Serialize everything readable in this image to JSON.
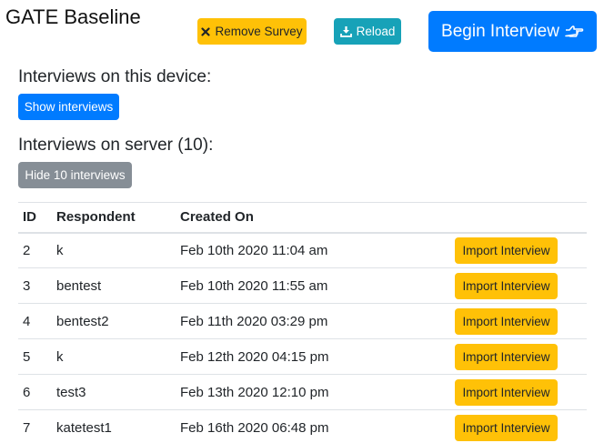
{
  "header": {
    "title": "GATE Baseline",
    "remove_label": "Remove Survey",
    "reload_label": "Reload",
    "begin_label": "Begin Interview"
  },
  "device_section": {
    "heading": "Interviews on this device:",
    "show_label": "Show interviews"
  },
  "server_section": {
    "heading": "Interviews on server (10):",
    "hide_label": "Hide 10 interviews"
  },
  "table": {
    "columns": [
      "ID",
      "Respondent",
      "Created On",
      ""
    ],
    "rows": [
      {
        "id": "2",
        "respondent": "k",
        "created": "Feb 10th 2020 11:04 am",
        "action": "Import Interview"
      },
      {
        "id": "3",
        "respondent": "bentest",
        "created": "Feb 10th 2020 11:55 am",
        "action": "Import Interview"
      },
      {
        "id": "4",
        "respondent": "bentest2",
        "created": "Feb 11th 2020 03:29 pm",
        "action": "Import Interview"
      },
      {
        "id": "5",
        "respondent": "k",
        "created": "Feb 12th 2020 04:15 pm",
        "action": "Import Interview"
      },
      {
        "id": "6",
        "respondent": "test3",
        "created": "Feb 13th 2020 12:10 pm",
        "action": "Import Interview"
      },
      {
        "id": "7",
        "respondent": "katetest1",
        "created": "Feb 16th 2020 06:48 pm",
        "action": "Import Interview"
      }
    ]
  },
  "icons": {
    "remove": "close-icon",
    "reload": "download-icon",
    "begin": "hand-pointing-right-icon"
  },
  "colors": {
    "primary": "#007bff",
    "warning": "#ffc107",
    "info": "#17a2b8",
    "secondary": "#868e96"
  }
}
